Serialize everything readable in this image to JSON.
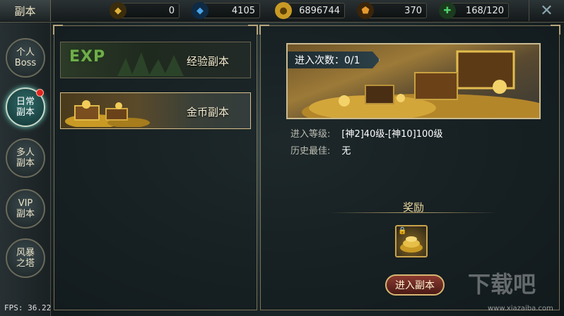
{
  "header": {
    "title": "副本",
    "resources": [
      {
        "name": "gold-gem",
        "value": "0",
        "icon": "gold-gem-icon",
        "color": "#e0b23a"
      },
      {
        "name": "diamond",
        "value": "4105",
        "icon": "blue-diamond-icon",
        "color": "#4aa3e6"
      },
      {
        "name": "coin",
        "value": "6896744",
        "icon": "gold-coin-icon",
        "color": "#e8c24a"
      },
      {
        "name": "crystal",
        "value": "370",
        "icon": "amber-crystal-icon",
        "color": "#e59a2e"
      },
      {
        "name": "stamina",
        "value": "168/120",
        "icon": "stamina-plus-icon",
        "color": "#4fcf6a"
      }
    ],
    "close_icon": "close-icon"
  },
  "sidenav": {
    "items": [
      {
        "label_line1": "个人",
        "label_line2": "Boss",
        "active": false
      },
      {
        "label_line1": "日常",
        "label_line2": "副本",
        "active": true,
        "notification": true
      },
      {
        "label_line1": "多人",
        "label_line2": "副本",
        "active": false
      },
      {
        "label_line1": "VIP",
        "label_line2": "副本",
        "active": false
      },
      {
        "label_line1": "风暴",
        "label_line2": "之塔",
        "active": false
      }
    ]
  },
  "dungeon_list": [
    {
      "label": "经验副本",
      "art_text": "EXP",
      "selected": false
    },
    {
      "label": "金币副本",
      "selected": true
    }
  ],
  "detail": {
    "entry_count": "进入次数：0/1",
    "level_label": "进入等级:",
    "level_value": "[神2]40级-[神10]100级",
    "best_label": "历史最佳:",
    "best_value": "无",
    "reward_title": "奖励",
    "enter_button": "进入副本"
  },
  "footer": {
    "fps_label": "FPS:",
    "fps_value": "36.22",
    "watermark_text": "下载吧",
    "watermark_url": "www.xiazaiba.com"
  }
}
